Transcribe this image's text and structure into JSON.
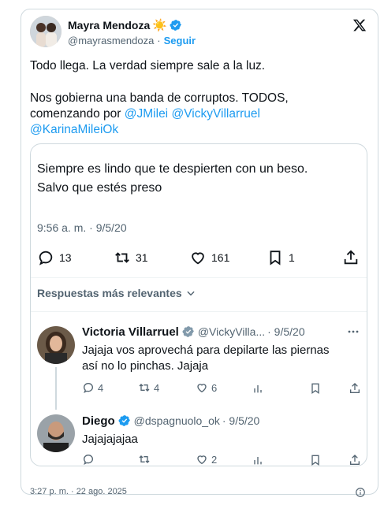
{
  "author": {
    "name": "Mayra Mendoza",
    "handle": "@mayrasmendoza",
    "separator": "·",
    "follow_label": "Seguir",
    "emoji": "☀️"
  },
  "tweet": {
    "line1": "Todo llega. La verdad siempre sale a la luz.",
    "line2": "Nos gobierna una banda de corruptos. TODOS,",
    "line3_prefix": "comenzando por ",
    "mention1": "@JMilei",
    "mention2": "@VickyVillarruel",
    "mention3": "@KarinaMileiOk"
  },
  "quoted": {
    "text_line1": "Siempre es lindo que te despierten con un beso.",
    "text_line2": "Salvo que estés preso",
    "timestamp": "9:56 a. m. · 9/5/20",
    "stats": {
      "replies": "13",
      "retweets": "31",
      "likes": "161",
      "bookmarks": "1"
    },
    "relevant_replies_label": "Respuestas más relevantes"
  },
  "replies": [
    {
      "name": "Victoria Villarruel",
      "handle": "@VickyVilla...",
      "date": "· 9/5/20",
      "text_line1": "Jajaja vos aprovechá para depilarte las piernas",
      "text_line2": "así no lo pinchas. Jajaja",
      "replies": "4",
      "retweets": "4",
      "likes": "6"
    },
    {
      "name": "Diego",
      "handle": "@dspagnuolo_ok",
      "date": "· 9/5/20",
      "text_line1": "Jajajajajaa",
      "replies": "",
      "retweets": "",
      "likes": "2"
    }
  ],
  "footer": {
    "timestamp": "3:27 p. m. · 22 ago. 2025"
  },
  "colors": {
    "accent": "#1d9bf0",
    "text": "#0f1419",
    "muted": "#536471",
    "border": "#cfd9de"
  },
  "icons": [
    "x-logo-icon",
    "verified-badge-icon",
    "reply-icon",
    "retweet-icon",
    "like-icon",
    "bookmark-icon",
    "share-icon",
    "views-icon",
    "more-icon",
    "chevron-down-icon",
    "info-icon"
  ]
}
